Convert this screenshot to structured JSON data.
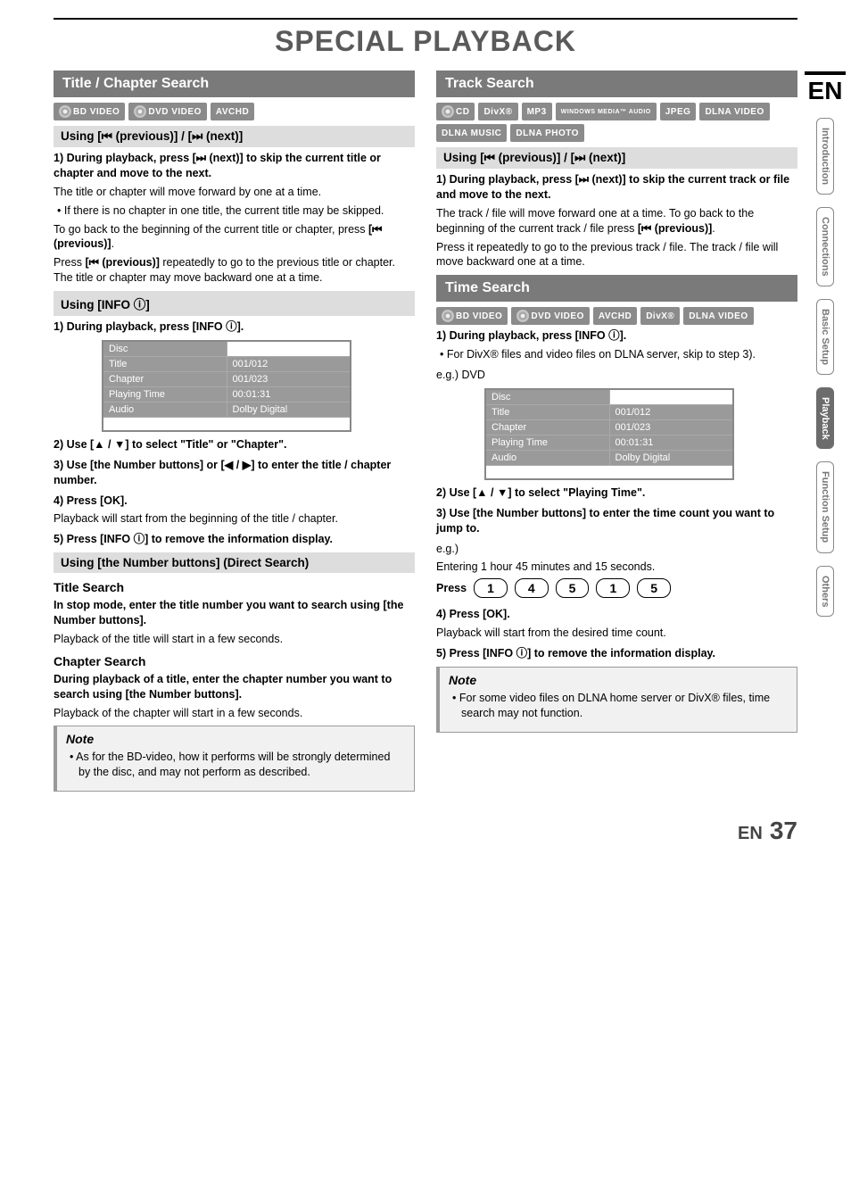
{
  "page_title": "SPECIAL PLAYBACK",
  "lang_tag": "EN",
  "side_tabs": [
    "Introduction",
    "Connections",
    "Basic Setup",
    "Playback",
    "Function Setup",
    "Others"
  ],
  "active_tab": "Playback",
  "footer": {
    "lang": "EN",
    "page": "37"
  },
  "left": {
    "heading": "Title / Chapter Search",
    "badges": [
      "BD VIDEO",
      "DVD VIDEO",
      "AVCHD"
    ],
    "sub1": "Using [⏮ (previous)] / [⏭ (next)]",
    "s1_bold": "During playback, press [⏭ (next)] to skip the current title or chapter and move to the next.",
    "s1_line1": "The title or chapter will move forward by one at a time.",
    "s1_bullet": "If there is no chapter in one title, the current title may be skipped.",
    "s1_p2a": "To go back to the beginning of the current title or chapter, press ",
    "s1_p2b": "[⏮ (previous)]",
    "s1_p2c": ".",
    "s1_p3a": "Press ",
    "s1_p3b": "[⏮ (previous)]",
    "s1_p3c": " repeatedly to go to the previous title or chapter. The title or chapter may move backward one at a time.",
    "sub2": "Using [INFO ⓘ]",
    "s2_step1": "During playback, press [INFO ⓘ].",
    "info_table": {
      "rows": [
        [
          "Disc",
          ""
        ],
        [
          "Title",
          "001/012"
        ],
        [
          "Chapter",
          "001/023"
        ],
        [
          "Playing Time",
          "00:01:31"
        ],
        [
          "Audio",
          "Dolby Digital"
        ]
      ]
    },
    "s2_step2": "Use [▲ / ▼] to select \"Title\" or \"Chapter\".",
    "s2_step3": "Use [the Number buttons] or [◀ / ▶] to enter the title / chapter number.",
    "s2_step4": "Press [OK].",
    "s2_step4_sub": "Playback will start from the beginning of the title / chapter.",
    "s2_step5": "Press [INFO ⓘ] to remove the information display.",
    "sub3": "Using [the Number buttons] (Direct Search)",
    "title_search_h": "Title Search",
    "title_search_b": "In stop mode, enter the title number you want to search using [the Number buttons].",
    "title_search_p": "Playback of the title will start in a few seconds.",
    "chapter_search_h": "Chapter Search",
    "chapter_search_b": "During playback of a title, enter the chapter number you want to search using [the Number buttons].",
    "chapter_search_p": "Playback of the chapter will start in a few seconds.",
    "note": "As for the BD-video, how it performs will be strongly determined by the disc, and may not perform as described."
  },
  "right": {
    "heading1": "Track Search",
    "badges1": [
      "CD",
      "DivX®",
      "MP3",
      "WINDOWS MEDIA™ AUDIO",
      "JPEG",
      "DLNA VIDEO",
      "DLNA MUSIC",
      "DLNA PHOTO"
    ],
    "sub1": "Using [⏮ (previous)] / [⏭ (next)]",
    "r1_bold": "During playback, press [⏭ (next)] to skip the current track or file and move to the next.",
    "r1_p1a": "The track / file will move forward one at a time. To go back to the beginning of the current track / file press ",
    "r1_p1b": "[⏮ (previous)]",
    "r1_p1c": ".",
    "r1_p2": "Press it repeatedly to go to the previous track / file. The track / file will move backward one at a time.",
    "heading2": "Time Search",
    "badges2": [
      "BD VIDEO",
      "DVD VIDEO",
      "AVCHD",
      "DivX®",
      "DLNA VIDEO"
    ],
    "t_step1": "During playback, press [INFO ⓘ].",
    "t_step1_bullet": "For DivX® files and video files on DLNA server, skip to step 3).",
    "eg_label": "e.g.) DVD",
    "info_table2": {
      "rows": [
        [
          "Disc",
          ""
        ],
        [
          "Title",
          "001/012"
        ],
        [
          "Chapter",
          "001/023"
        ],
        [
          "Playing Time",
          "00:01:31"
        ],
        [
          "Audio",
          "Dolby Digital"
        ]
      ]
    },
    "t_step2": "Use [▲ / ▼] to select \"Playing Time\".",
    "t_step3": "Use [the Number buttons] to enter the time count you want to jump to.",
    "eg2": "e.g.)",
    "eg2_line": "Entering 1 hour 45 minutes and 15 seconds.",
    "press_label": "Press",
    "press_digits": [
      "1",
      "4",
      "5",
      "1",
      "5"
    ],
    "t_step4": "Press [OK].",
    "t_step4_sub": "Playback will start from the desired time count.",
    "t_step5": "Press [INFO ⓘ] to remove the information display.",
    "note": "For some video files on DLNA home server or DivX® files, time search may not function."
  },
  "note_label": "Note"
}
